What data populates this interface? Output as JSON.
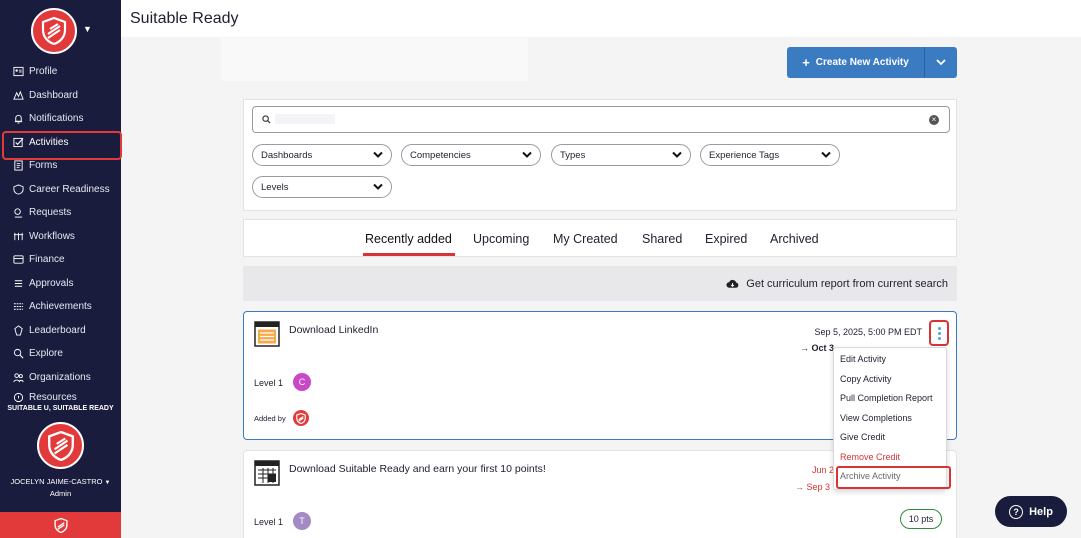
{
  "app": {
    "title": "Suitable Ready"
  },
  "sidebar": {
    "items": [
      {
        "label": "Profile",
        "icon": "profile-icon"
      },
      {
        "label": "Dashboard",
        "icon": "dashboard-icon"
      },
      {
        "label": "Notifications",
        "icon": "bell-icon"
      },
      {
        "label": "Activities",
        "icon": "checkbox-icon",
        "active": true
      },
      {
        "label": "Forms",
        "icon": "form-icon"
      },
      {
        "label": "Career Readiness",
        "icon": "career-icon"
      },
      {
        "label": "Requests",
        "icon": "requests-icon"
      },
      {
        "label": "Workflows",
        "icon": "workflow-icon"
      },
      {
        "label": "Finance",
        "icon": "finance-icon"
      },
      {
        "label": "Approvals",
        "icon": "approvals-icon"
      },
      {
        "label": "Achievements",
        "icon": "achievements-icon"
      },
      {
        "label": "Leaderboard",
        "icon": "leaderboard-icon"
      },
      {
        "label": "Explore",
        "icon": "explore-icon"
      },
      {
        "label": "Organizations",
        "icon": "organizations-icon"
      },
      {
        "label": "Resources",
        "icon": "resources-icon"
      }
    ],
    "org_name": "SUITABLE U, SUITABLE READY",
    "user_name": "JOCELYN JAIME-CASTRO",
    "user_role": "Admin"
  },
  "toolbar": {
    "create_label": "Create New Activity"
  },
  "filters": {
    "search_value": "",
    "selects": [
      "Dashboards",
      "Competencies",
      "Types",
      "Experience Tags",
      "Levels"
    ]
  },
  "tabs": [
    "Recently added",
    "Upcoming",
    "My Created",
    "Shared",
    "Expired",
    "Archived"
  ],
  "curriculum_report": "Get curriculum report from current search",
  "activities": [
    {
      "title": "Download LinkedIn",
      "date": "Sep 5, 2025, 5:00 PM EDT",
      "date2": "→ Oct 3",
      "level": "Level 1",
      "avatar": "C",
      "added_by": "Added by"
    },
    {
      "title": "Download Suitable Ready and earn your first 10 points!",
      "date": "Jun 2",
      "date2": "→ Sep 3",
      "level": "Level 1",
      "avatar": "T",
      "points": "10 pts"
    }
  ],
  "menu": {
    "items": [
      "Edit Activity",
      "Copy Activity",
      "Pull Completion Report",
      "View Completions",
      "Give Credit",
      "Remove Credit",
      "Archive Activity"
    ]
  },
  "help": {
    "label": "Help"
  },
  "colors": {
    "sidebar_bg": "#1a1c3d",
    "brand_red": "#e23a3a",
    "primary_blue": "#3b7bc2"
  }
}
